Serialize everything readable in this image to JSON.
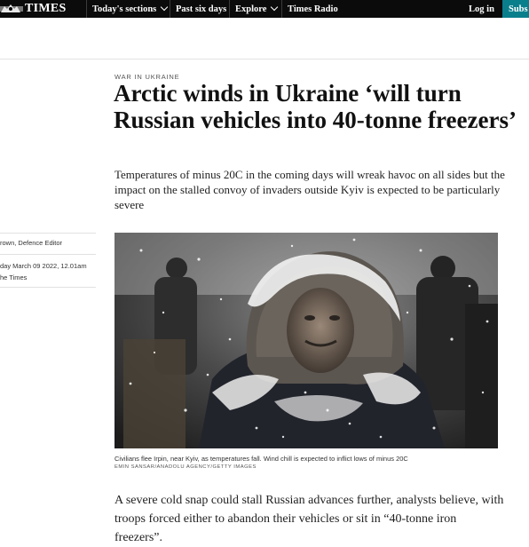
{
  "nav": {
    "logo": "TIMES",
    "items": [
      {
        "label": "Today's sections",
        "has_dropdown": true
      },
      {
        "label": "Past six days",
        "has_dropdown": false
      },
      {
        "label": "Explore",
        "has_dropdown": true
      },
      {
        "label": "Times Radio",
        "has_dropdown": false
      }
    ],
    "login_label": "Log in",
    "subscribe_label": "Subs"
  },
  "article": {
    "section": "WAR IN UKRAINE",
    "headline": "Arctic winds in Ukraine ‘will turn Russian vehicles into 40-tonne freezers’",
    "standfirst": "Temperatures of minus 20C in the coming days will wreak havoc on all sides but the impact on the stalled convoy of invaders outside Kyiv is expected to be particularly severe",
    "byline": {
      "author": "rown, Defence Editor",
      "date_line1": "day March 09 2022, 12.01am",
      "date_line2": "he Times"
    },
    "image": {
      "caption": "Civilians flee Irpin, near Kyiv, as temperatures fall. Wind chill is expected to inflict lows of minus 20C",
      "credit": "EMIN SANSAR/ANADOLU AGENCY/GETTY IMAGES"
    },
    "body_first_paragraph": "A severe cold snap could stall Russian advances further, analysts believe, with troops forced either to abandon their vehicles or sit in “40-tonne iron freezers”."
  },
  "colors": {
    "nav_background": "#0b0b0b",
    "subscribe_accent": "#0a7f8c"
  }
}
